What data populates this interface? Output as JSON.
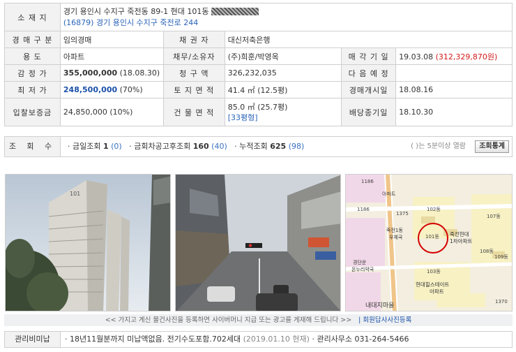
{
  "info": {
    "address_label": "소 재 지",
    "address": "경기 용인시 수지구 죽전동 89-1 현대 101동",
    "address_road": "(16879) 경기 용인시 수지구 죽전로 244",
    "type_label": "경 매 구 분",
    "type_value": "임의경매",
    "creditor_label": "채 권 자",
    "creditor_value": "대신저축은행",
    "use_label": "용 도",
    "use_value": "아파트",
    "debtor_label": "채무/소유자",
    "debtor_value": "(주)희훈/박영옥",
    "sale_date_label": "매 각 기 일",
    "sale_date": "19.03.08",
    "sale_amount": "(312,329,870원)",
    "appraisal_label": "감 정 가",
    "appraisal_value": "355,000,000",
    "appraisal_date": "(18.08.30)",
    "claim_label": "청 구 액",
    "claim_value": "326,232,035",
    "next_label": "다 음 예 정",
    "next_value": "",
    "min_label": "최 저 가",
    "min_value": "248,500,000",
    "min_pct": "(70%)",
    "land_label": "토 지 면 적",
    "land_value": "41.4 ㎡ (12.5평)",
    "start_label": "경매개시일",
    "start_value": "18.08.16",
    "deposit_label": "입찰보증금",
    "deposit_value": "24,850,000 (10%)",
    "building_label": "건 물 면 적",
    "building_value": "85.0 ㎡ (25.7평)",
    "building_type": "[33평형]",
    "dividend_label": "배당종기일",
    "dividend_value": "18.10.30"
  },
  "views": {
    "label": "조 회 수",
    "today_label": "· 금일조회",
    "today_count": "1",
    "today_paren": "(0)",
    "after_label": "· 금회차공고후조회",
    "after_count": "160",
    "after_paren": "(40)",
    "total_label": "· 누적조회",
    "total_count": "625",
    "total_paren": "(98)",
    "note": "( )는 5분이상 열람",
    "stats_button": "조회통계"
  },
  "photos": {
    "map_labels": [
      "1186",
      "1375",
      "죽전1동 우체국",
      "죽전현대 1차아파트",
      "경단운 온누리약국",
      "현대힐스테이트 아파트",
      "내대지마을",
      "아파트",
      "1370",
      "102동",
      "103동",
      "107동",
      "108동",
      "109동",
      "101동"
    ]
  },
  "banner": {
    "text": "<< 가지고 계신 물건사진을 등록하면 사이버머니 지급 또는 광고를 게재해 드립니다 >>",
    "register_link": "| 회원답사사진등록"
  },
  "management": {
    "label": "관리비미납",
    "text_main": "· 18년11월분까지 미납액없음. 전기수도포함.702세대",
    "text_date": "(2019.01.10 현재)",
    "text_office": "· 관리사무소 031-264-5466"
  }
}
